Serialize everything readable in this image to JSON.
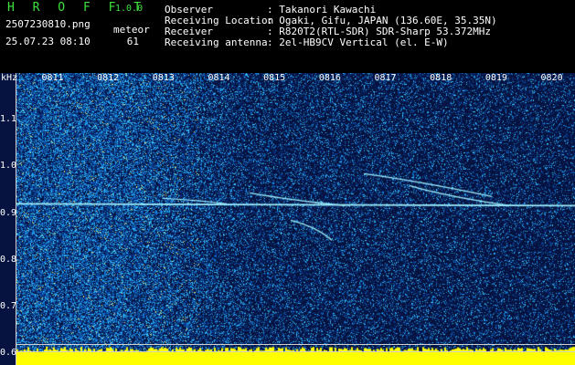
{
  "app": {
    "logo": "H R O F F T",
    "version": "1.0.0",
    "filename": "2507230810.png",
    "datetime": "25.07.23 08:10",
    "meteor_label": "meteor",
    "meteor_count": "61"
  },
  "info": [
    {
      "label": "Observer",
      "value": ": Takanori Kawachi"
    },
    {
      "label": "Receiving Location",
      "value": ": Ogaki, Gifu, JAPAN (136.60E, 35.35N)"
    },
    {
      "label": "Receiver",
      "value": ": R820T2(RTL-SDR) SDR-Sharp 53.372MHz"
    },
    {
      "label": "Receiving antenna",
      "value": ": 2el-HB9CV Vertical (el. E-W)"
    }
  ],
  "spectrogram": {
    "y_unit": "kHz",
    "y_ticks": [
      "1.1",
      "1.0",
      "0.9",
      "0.8",
      "0.7",
      "0.6"
    ],
    "y_tick_values": [
      1.1,
      1.0,
      0.9,
      0.8,
      0.7,
      0.6
    ],
    "y_range": [
      0.575,
      1.2
    ],
    "x_ticks": [
      "0811",
      "0812",
      "0813",
      "0814",
      "0815",
      "0816",
      "0817",
      "0818",
      "0819",
      "0820"
    ],
    "x_range_minutes": [
      10.35,
      20.42
    ],
    "x_tick_minutes": [
      11,
      12,
      13,
      14,
      15,
      16,
      17,
      18,
      19,
      20
    ],
    "carrier_khz": 0.92,
    "reference_lines_khz": [
      0.62,
      0.605
    ],
    "colors": {
      "background": "#061340",
      "noise": "#1a8fd8",
      "echo": "#9ff0ff",
      "strong": "#ffd21a",
      "baseline": "#ffff00"
    }
  }
}
